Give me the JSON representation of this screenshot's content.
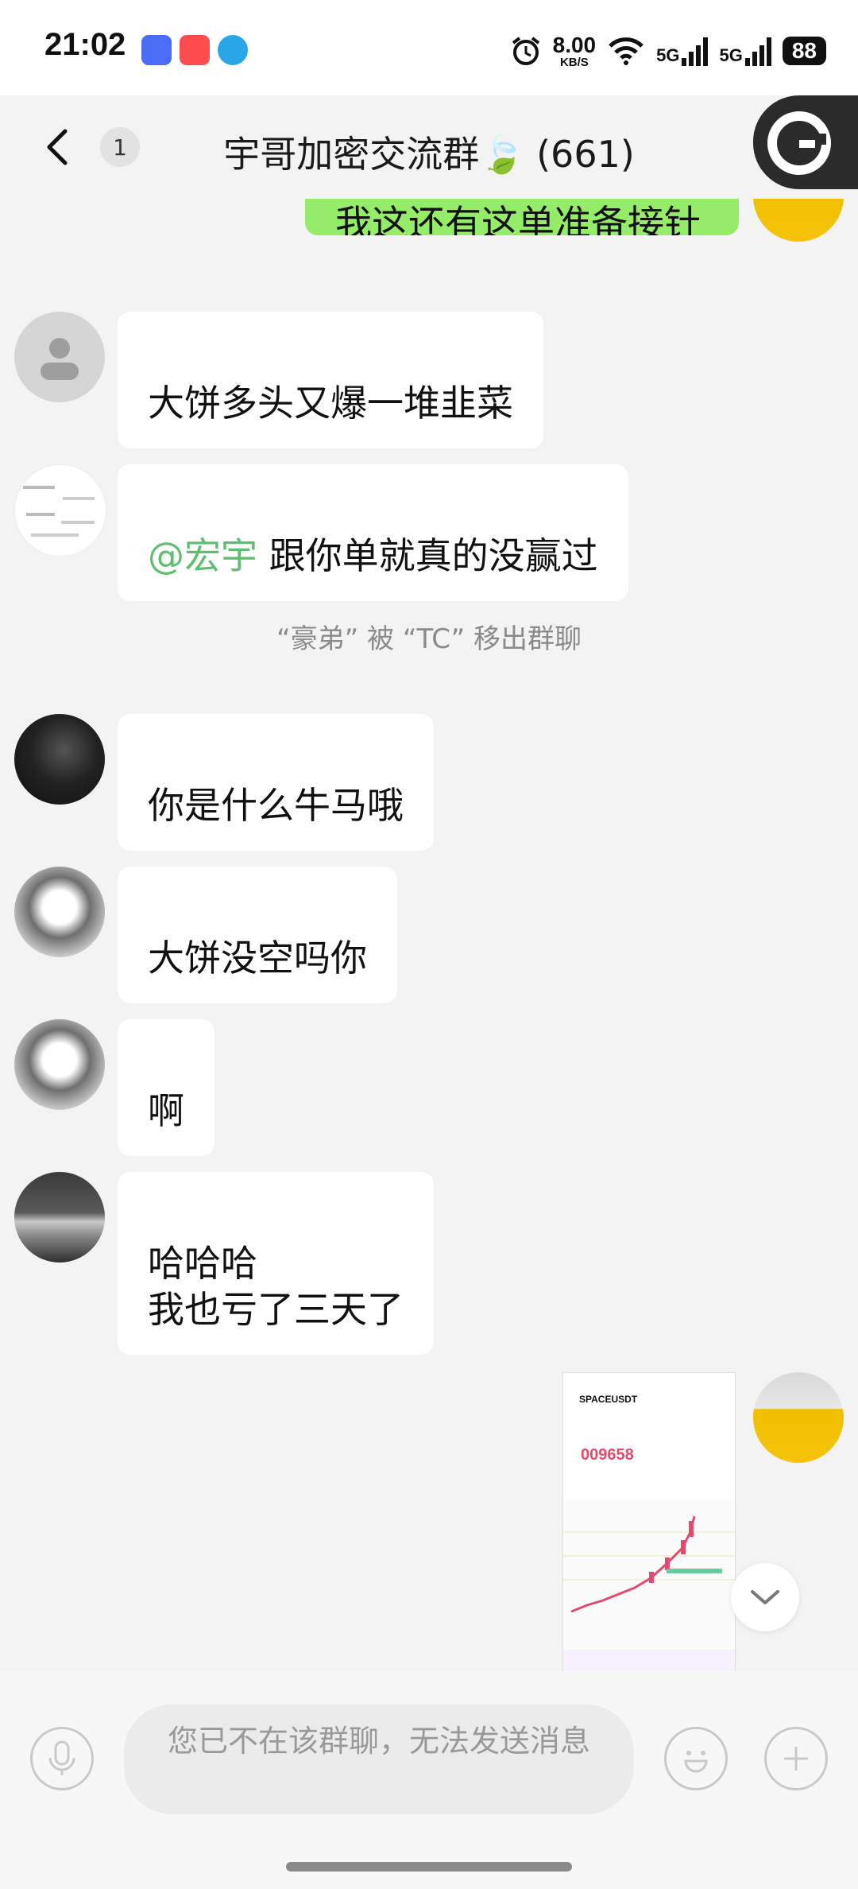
{
  "status_bar": {
    "time": "21:02",
    "net_speed": "8.00",
    "net_unit": "KB/S",
    "net1": "5G",
    "net2": "5G",
    "battery": "88"
  },
  "header": {
    "unread_count": "1",
    "title": "宇哥加密交流群🍃 (661)"
  },
  "messages": [
    {
      "text": "我这还有这单准备接针"
    },
    {
      "text": "大饼多头又爆一堆韭菜"
    },
    {
      "mention": "@宏宇",
      "text": " 跟你单就真的没赢过"
    },
    {
      "text": "你是什么牛马哦"
    },
    {
      "text": "大饼没空吗你"
    },
    {
      "text": "啊"
    },
    {
      "text": "哈哈哈\n我也亏了三天了"
    }
  ],
  "system_notice": "“豪弟” 被 “TC” 移出群聊",
  "image_message": {
    "symbol": "SPACEUSDT",
    "price": "009658"
  },
  "input": {
    "disabled_text": "您已不在该群聊，无法发送消息"
  },
  "colors": {
    "accent_green": "#95ec69",
    "mention": "#5fbf6e"
  }
}
